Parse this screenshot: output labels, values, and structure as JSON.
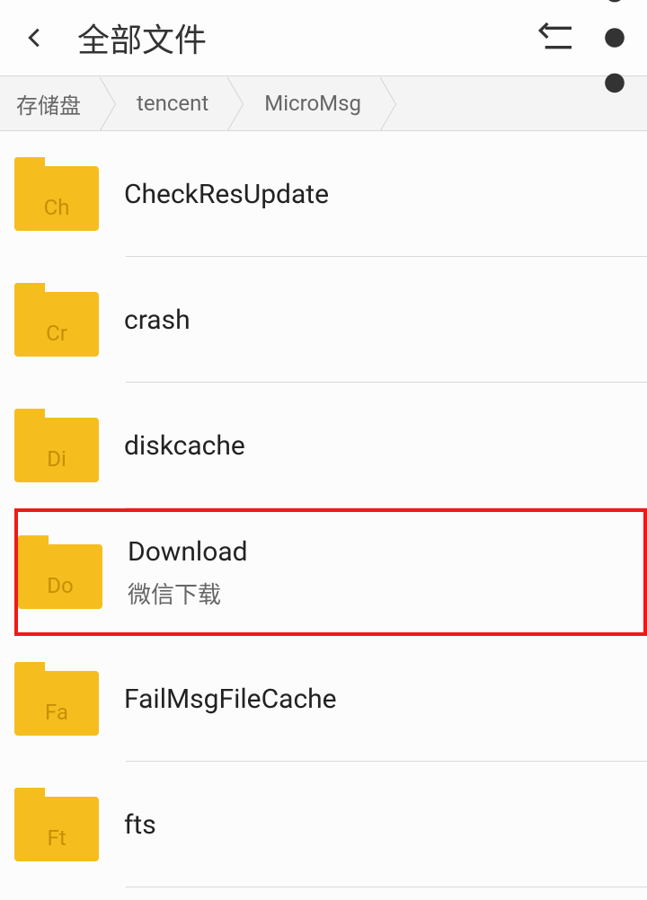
{
  "header": {
    "title": "全部文件"
  },
  "breadcrumbs": [
    {
      "label": "存储盘"
    },
    {
      "label": "tencent"
    },
    {
      "label": "MicroMsg"
    }
  ],
  "files": [
    {
      "abbr": "Ch",
      "name": "CheckResUpdate",
      "sub": null,
      "highlighted": false
    },
    {
      "abbr": "Cr",
      "name": "crash",
      "sub": null,
      "highlighted": false
    },
    {
      "abbr": "Di",
      "name": "diskcache",
      "sub": null,
      "highlighted": false
    },
    {
      "abbr": "Do",
      "name": "Download",
      "sub": "微信下载",
      "highlighted": true
    },
    {
      "abbr": "Fa",
      "name": "FailMsgFileCache",
      "sub": null,
      "highlighted": false
    },
    {
      "abbr": "Ft",
      "name": "fts",
      "sub": null,
      "highlighted": false
    }
  ]
}
